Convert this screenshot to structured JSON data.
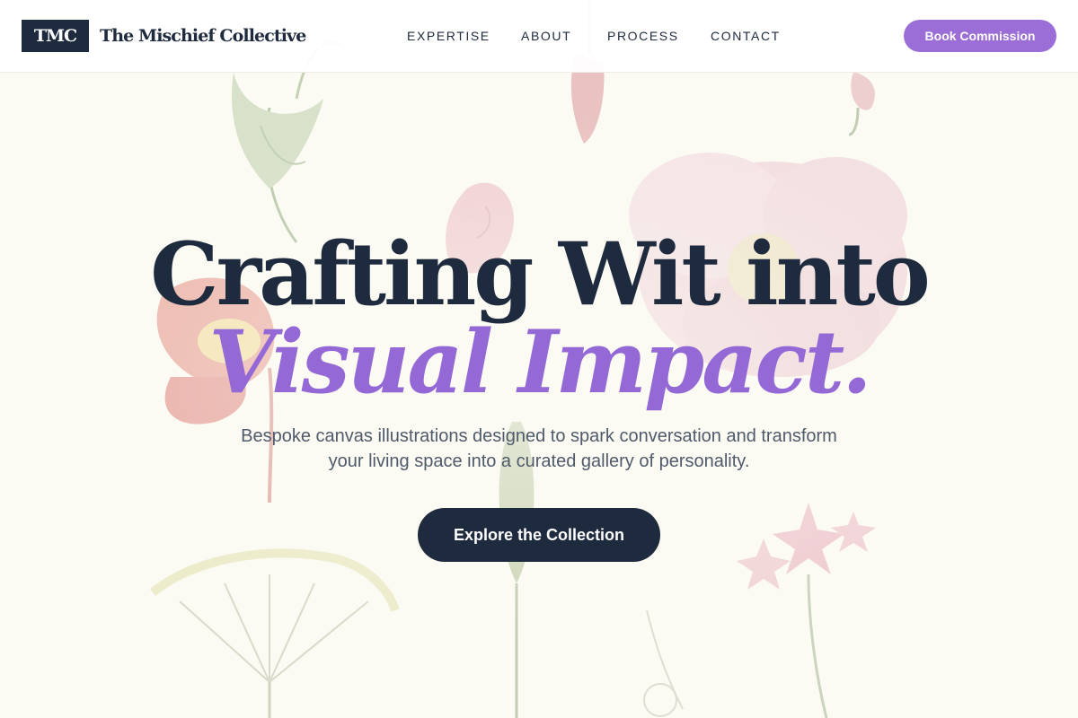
{
  "brand": {
    "mark": "TMC",
    "name": "The Mischief Collective"
  },
  "nav": {
    "items": [
      {
        "label": "EXPERTISE"
      },
      {
        "label": "ABOUT"
      },
      {
        "label": "PROCESS"
      },
      {
        "label": "CONTACT"
      }
    ],
    "cta_label": "Book Commission"
  },
  "hero": {
    "headline_line1": "Crafting Wit into",
    "headline_line2": "Visual Impact.",
    "subtitle": "Bespoke canvas illustrations designed to spark conversation and transform your living space into a curated gallery of personality.",
    "cta_label": "Explore the Collection"
  },
  "colors": {
    "navy": "#1e2a3e",
    "accent_purple": "#9b6dd7",
    "page_background": "#fbfaf3",
    "subtitle_gray": "#4f5a6b"
  },
  "icons": [
    "botanical-illustration-background"
  ]
}
